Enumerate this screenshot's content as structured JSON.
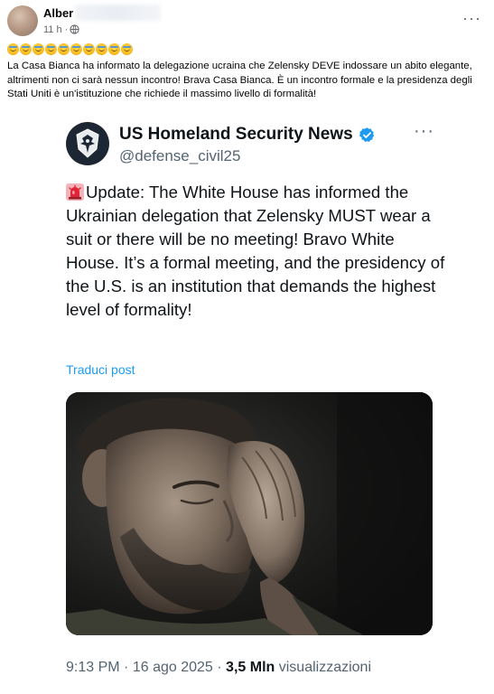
{
  "facebook_post": {
    "author_name": "Alber",
    "time": "11 h ·",
    "more_label": "···",
    "emoji_count": 10,
    "text": "La Casa Bianca ha informato la delegazione ucraina che Zelensky DEVE indossare un abito elegante, altrimenti non ci sarà nessun incontro! Brava Casa Bianca. È un incontro formale e la presidenza degli Stati Uniti è un'istituzione che richiede il massimo livello di formalità!"
  },
  "tweet": {
    "display_name": "US Homeland Security News",
    "handle": "@defense_civil25",
    "more_label": "···",
    "body": "Update: The White House has informed the Ukrainian delegation that Zelensky MUST wear a suit or there will be no meeting! Bravo White House. It’s a formal meeting, and the presidency of the U.S. is an institution that demands the highest level of formality!",
    "translate_label": "Traduci post",
    "time": "9:13 PM",
    "date": "16 ago 2025",
    "views_count": "3,5 Mln",
    "views_label": "visualizzazioni",
    "separator": "·"
  },
  "colors": {
    "link": "#1d9bf0",
    "verified": "#1d9bf0",
    "secondary_text": "#536471"
  }
}
